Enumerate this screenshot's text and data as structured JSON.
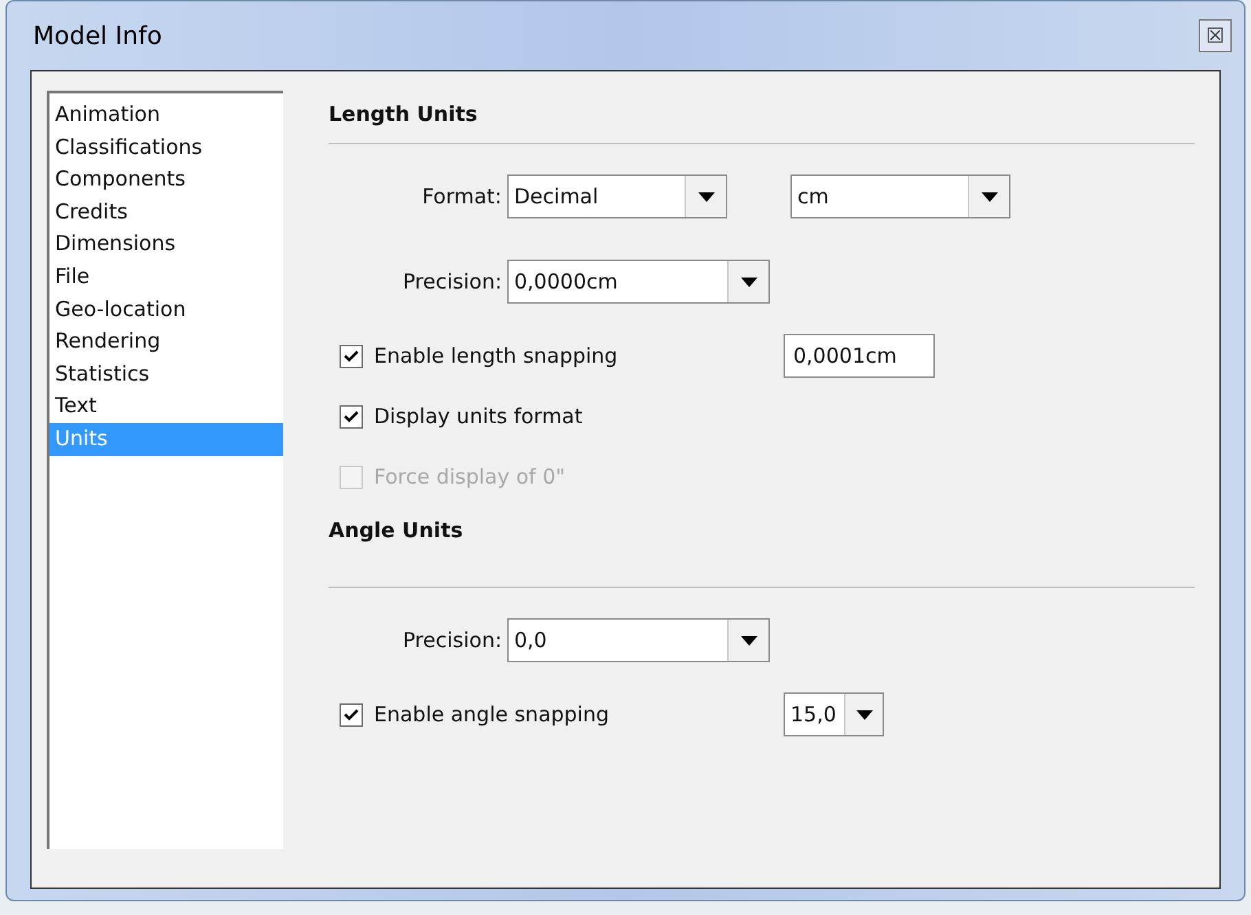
{
  "window": {
    "title": "Model Info",
    "close_button": "☒"
  },
  "sidebar": {
    "items": [
      {
        "label": "Animation",
        "selected": false
      },
      {
        "label": "Classifications",
        "selected": false
      },
      {
        "label": "Components",
        "selected": false
      },
      {
        "label": "Credits",
        "selected": false
      },
      {
        "label": "Dimensions",
        "selected": false
      },
      {
        "label": "File",
        "selected": false
      },
      {
        "label": "Geo-location",
        "selected": false
      },
      {
        "label": "Rendering",
        "selected": false
      },
      {
        "label": "Statistics",
        "selected": false
      },
      {
        "label": "Text",
        "selected": false
      },
      {
        "label": "Units",
        "selected": true
      }
    ]
  },
  "sections": [
    {
      "title": "Length Units",
      "rows": [
        {
          "kind": "fields",
          "label": "Format:",
          "controls": [
            {
              "kind": "dropdown",
              "value": "Decimal"
            },
            {
              "kind": "dropdown",
              "value": "cm"
            }
          ]
        },
        {
          "kind": "fields",
          "label": "Precision:",
          "controls": [
            {
              "kind": "dropdown",
              "value": "0,0000cm"
            }
          ]
        },
        {
          "kind": "checkbox",
          "label": "Enable length snapping",
          "checked": true,
          "disabled": false,
          "controls": [
            {
              "kind": "textbox",
              "value": "0,0001cm"
            }
          ]
        },
        {
          "kind": "checkbox",
          "label": "Display units format",
          "checked": true,
          "disabled": false
        },
        {
          "kind": "checkbox",
          "label": "Force display of 0\"",
          "checked": false,
          "disabled": true
        }
      ]
    },
    {
      "title": "Angle Units",
      "rows": [
        {
          "kind": "fields",
          "label": "Precision:",
          "controls": [
            {
              "kind": "dropdown",
              "value": "0,0"
            }
          ]
        },
        {
          "kind": "checkbox",
          "label": "Enable angle snapping",
          "checked": true,
          "disabled": false,
          "controls": [
            {
              "kind": "dropdown",
              "value": "15,0"
            }
          ]
        }
      ]
    }
  ]
}
